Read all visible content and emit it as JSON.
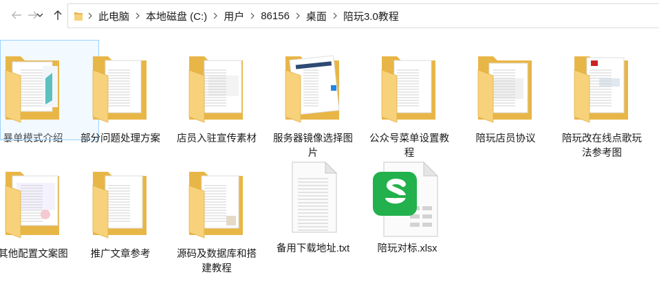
{
  "nav": {
    "back_icon": "arrow-left-icon",
    "forward_icon": "arrow-right-icon",
    "history_icon": "chevron-down-icon",
    "up_icon": "arrow-up-icon"
  },
  "breadcrumb": [
    "此电脑",
    "本地磁盘 (C:)",
    "用户",
    "86156",
    "桌面",
    "陪玩3.0教程"
  ],
  "items": [
    {
      "name": "暴单模式介绍",
      "type": "folder",
      "selected": true
    },
    {
      "name": "部分问题处理方案",
      "type": "folder"
    },
    {
      "name": "店员入驻宣传素材",
      "type": "folder"
    },
    {
      "name": "服务器镜像选择图片",
      "type": "folder"
    },
    {
      "name": "公众号菜单设置教程",
      "type": "folder"
    },
    {
      "name": "陪玩店员协议",
      "type": "folder"
    },
    {
      "name": "陪玩改在线点歌玩法参考图",
      "type": "folder"
    },
    {
      "name": "其他配置文案图",
      "type": "folder"
    },
    {
      "name": "推广文章参考",
      "type": "folder"
    },
    {
      "name": "源码及数据库和搭建教程",
      "type": "folder"
    },
    {
      "name": "备用下载地址.txt",
      "type": "txt"
    },
    {
      "name": "陪玩对标.xlsx",
      "type": "xlsx"
    }
  ],
  "colors": {
    "folder_back": "#e8b646",
    "folder_front": "#f7d27a",
    "paper": "#fbfbfb",
    "sheet_green": "#22b14c",
    "selection": "#cce8ff"
  }
}
